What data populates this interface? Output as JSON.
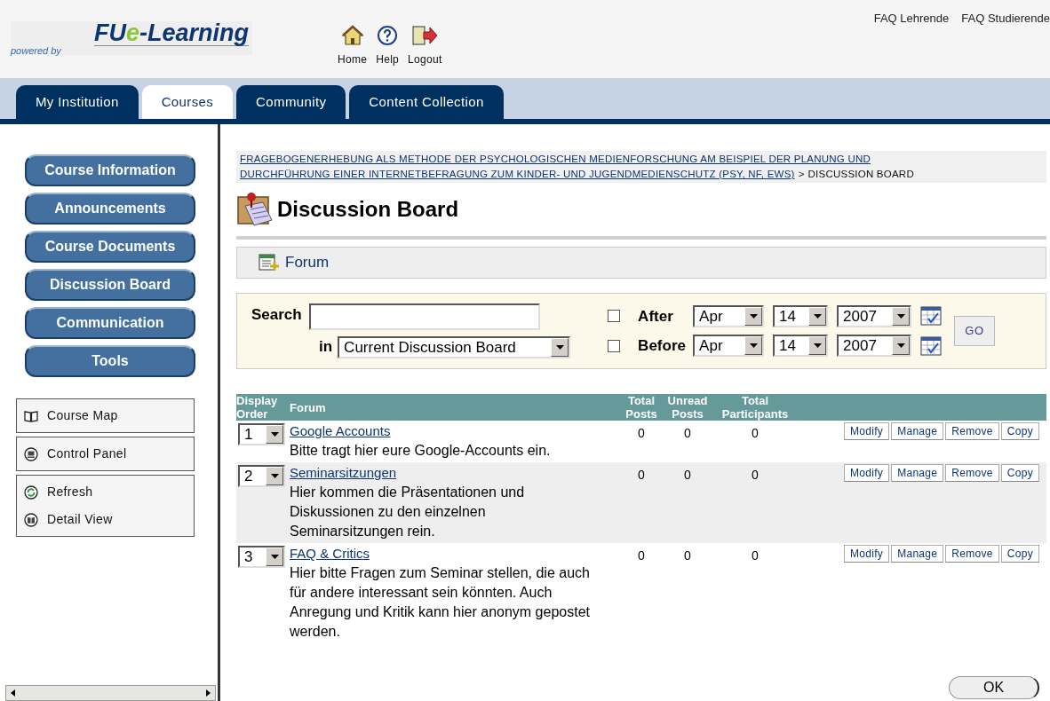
{
  "header": {
    "logo": {
      "tagline": "powered by",
      "segments": [
        {
          "text": "FU",
          "kind": "plain"
        },
        {
          "text": "e",
          "kind": "accent"
        },
        {
          "text": "-Learning",
          "kind": "plain"
        }
      ]
    },
    "nav_icons": [
      {
        "label": "Home",
        "kind": "home"
      },
      {
        "label": "Help",
        "kind": "help"
      },
      {
        "label": "Logout",
        "kind": "logout"
      }
    ],
    "faq_links": [
      "FAQ Lehrende",
      "FAQ Studierende"
    ]
  },
  "tabs": [
    {
      "label": "My Institution",
      "selected": false
    },
    {
      "label": "Courses",
      "selected": true
    },
    {
      "label": "Community",
      "selected": false
    },
    {
      "label": "Content Collection",
      "selected": false
    }
  ],
  "sidebar": {
    "menu": [
      "Course Information",
      "Announcements",
      "Course Documents",
      "Discussion Board",
      "Communication",
      "Tools"
    ],
    "tool_groups": [
      [
        {
          "label": "Course Map",
          "kind": "map"
        }
      ],
      [
        {
          "label": "Control Panel",
          "kind": "panel"
        }
      ],
      [
        {
          "label": "Refresh",
          "kind": "refresh"
        },
        {
          "label": "Detail View",
          "kind": "detail"
        }
      ]
    ]
  },
  "breadcrumb": {
    "link_lines": [
      "FRAGEBOGENERHEBUNG ALS METHODE DER PSYCHOLOGISCHEN MEDIENFORSCHUNG AM BEISPIEL DER PLANUNG UND",
      "DURCHFÜHRUNG EINER INTERNETBEFRAGUNG ZUM KINDER- UND JUGENDMEDIENSCHUTZ (PSY, NF, EWS)"
    ],
    "separator": ">",
    "current": "DISCUSSION BOARD"
  },
  "page_title": "Discussion Board",
  "action_bar": {
    "button": "Forum"
  },
  "search": {
    "label": "Search",
    "in_label": "in",
    "scope": "Current Discussion Board",
    "date_filters": [
      {
        "label": "After",
        "checked": false,
        "month": "Apr",
        "day": "14",
        "year": "2007"
      },
      {
        "label": "Before",
        "checked": false,
        "month": "Apr",
        "day": "14",
        "year": "2007"
      }
    ],
    "go": "GO"
  },
  "table": {
    "columns": [
      "Display Order",
      "Forum",
      "Total Posts",
      "Unread Posts",
      "Total Participants"
    ],
    "rows": [
      {
        "order": "1",
        "title": "Google Accounts",
        "description": "Bitte tragt hier eure Google-Accounts ein.",
        "total_posts": "0",
        "unread_posts": "0",
        "participants": "0",
        "actions": [
          "Modify",
          "Manage",
          "Remove",
          "Copy"
        ]
      },
      {
        "order": "2",
        "title": "Seminarsitzungen",
        "description": "Hier kommen die Präsentationen und Diskussionen zu den einzelnen Seminarsitzungen rein.",
        "total_posts": "0",
        "unread_posts": "0",
        "participants": "0",
        "actions": [
          "Modify",
          "Manage",
          "Remove",
          "Copy"
        ]
      },
      {
        "order": "3",
        "title": "FAQ & Critics",
        "description": "Hier bitte Fragen zum Seminar stellen, die auch für andere interessant sein könnten. Auch Anregung und Kritik kann hier anonym gepostet werden.",
        "total_posts": "0",
        "unread_posts": "0",
        "participants": "0",
        "actions": [
          "Modify",
          "Manage",
          "Remove",
          "Copy"
        ]
      }
    ]
  },
  "ok_button": "OK"
}
